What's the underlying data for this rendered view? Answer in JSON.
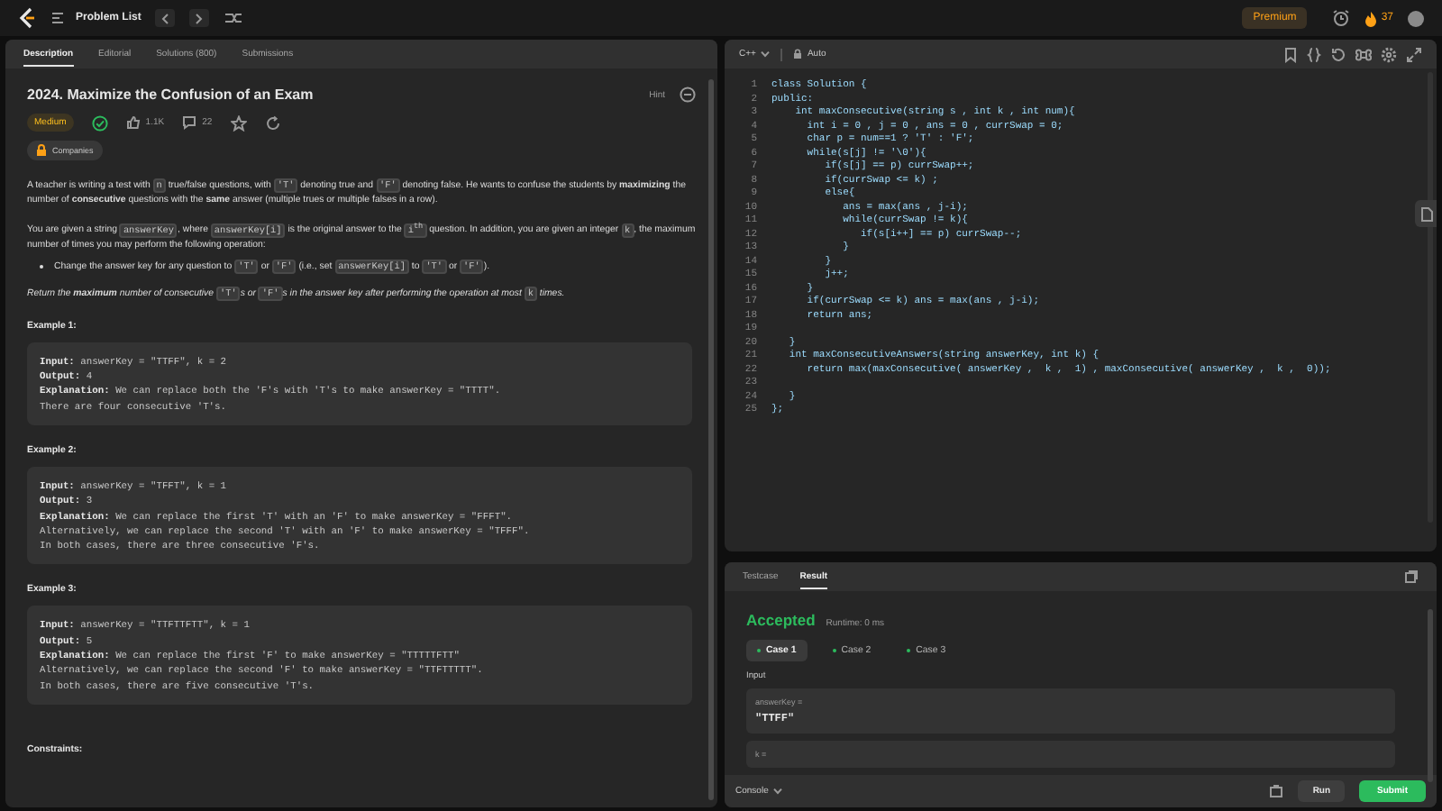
{
  "top_bar": {
    "title": "Problem List",
    "premium": "Premium",
    "streak": "37"
  },
  "description_panel": {
    "tabs": [
      {
        "label": "Description",
        "selected": true
      },
      {
        "label": "Editorial",
        "selected": false
      },
      {
        "label": "Solutions (800)",
        "selected": false
      },
      {
        "label": "Submissions",
        "selected": false
      }
    ],
    "title": "2024. Maximize the Confusion of an Exam",
    "hint": "Hint",
    "difficulty": "Medium",
    "solved": true,
    "likes": "1.1K",
    "comments": "22",
    "companies": "Companies",
    "paragraphs": [
      {
        "kind": "paragraph",
        "segments": [
          {
            "kind": "text",
            "text": "A teacher is writing a test with "
          },
          {
            "kind": "code",
            "text": "n"
          },
          {
            "kind": "text",
            "text": " true/false questions, with "
          },
          {
            "kind": "code",
            "text": "'T'"
          },
          {
            "kind": "text",
            "text": " denoting true and "
          },
          {
            "kind": "code",
            "text": "'F'"
          },
          {
            "kind": "text",
            "text": " denoting false. He wants to confuse the students by **maximizing** the number of **consecutive** questions with the **same** answer (multiple trues or multiple falses in a row)."
          }
        ]
      },
      {
        "kind": "paragraph",
        "segments": [
          {
            "kind": "text",
            "text": "You are given a string "
          },
          {
            "kind": "code",
            "text": "answerKey"
          },
          {
            "kind": "text",
            "text": ", where "
          },
          {
            "kind": "code",
            "text": "answerKey[i]"
          },
          {
            "kind": "text",
            "text": " is the original answer to the "
          },
          {
            "kind": "code",
            "text": "i$^{th}$"
          },
          {
            "kind": "text",
            "text": " question. In addition, you are given an integer "
          },
          {
            "kind": "code",
            "text": "k"
          },
          {
            "kind": "text",
            "text": ", the maximum number of times you may perform the following operation:"
          }
        ]
      },
      {
        "kind": "bullet",
        "segments": [
          {
            "kind": "text",
            "text": "Change the answer key for any question to "
          },
          {
            "kind": "code",
            "text": "'T'"
          },
          {
            "kind": "text",
            "text": " or "
          },
          {
            "kind": "code",
            "text": "'F'"
          },
          {
            "kind": "text",
            "text": " (i.e., set "
          },
          {
            "kind": "code",
            "text": "answerKey[i]"
          },
          {
            "kind": "text",
            "text": " to "
          },
          {
            "kind": "code",
            "text": "'T'"
          },
          {
            "kind": "text",
            "text": " or "
          },
          {
            "kind": "code",
            "text": "'F'"
          },
          {
            "kind": "text",
            "text": ")."
          }
        ]
      },
      {
        "kind": "note",
        "segments": [
          {
            "kind": "text",
            "text": "Return the **maximum** number of consecutive "
          },
          {
            "kind": "code",
            "text": "'T'"
          },
          {
            "kind": "text",
            "text": "s or "
          },
          {
            "kind": "code",
            "text": "'F'"
          },
          {
            "kind": "text",
            "text": "s in the answer key after performing the operation at most "
          },
          {
            "kind": "code",
            "text": "k"
          },
          {
            "kind": "text",
            "text": " times."
          }
        ]
      }
    ],
    "examples": [
      {
        "heading": "Example 1:",
        "lines": [
          "**Input:** answerKey = \"TTFF\", k = 2",
          "**Output:** 4",
          "**Explanation:** We can replace both the 'F's with 'T's to make answerKey = \"TTTT\".",
          "There are four consecutive 'T's."
        ]
      },
      {
        "heading": "Example 2:",
        "lines": [
          "**Input:** answerKey = \"TFFT\", k = 1",
          "**Output:** 3",
          "**Explanation:** We can replace the first 'T' with an 'F' to make answerKey = \"FFFT\".",
          "Alternatively, we can replace the second 'T' with an 'F' to make answerKey = \"TFFF\".",
          "In both cases, there are three consecutive 'F's."
        ]
      },
      {
        "heading": "Example 3:",
        "lines": [
          "**Input:** answerKey = \"TTFTTFTT\", k = 1",
          "**Output:** 5",
          "**Explanation:** We can replace the first 'F' to make answerKey = \"TTTTTFTT\"",
          "Alternatively, we can replace the second 'F' to make answerKey = \"TTFTTTTT\".",
          "In both cases, there are five consecutive 'T's."
        ]
      }
    ],
    "constraints_heading": "Constraints:"
  },
  "editor": {
    "language": "C++",
    "mode": "Auto",
    "lines": [
      {
        "n": "1",
        "code": "class Solution {"
      },
      {
        "n": "2",
        "code": "public:"
      },
      {
        "n": "3",
        "code": "    int maxConsecutive(string s , int k , int num){"
      },
      {
        "n": "4",
        "code": "      int i = 0 , j = 0 , ans = 0 , currSwap = 0;"
      },
      {
        "n": "5",
        "code": "      char p = num==1 ? 'T' : 'F';"
      },
      {
        "n": "6",
        "code": "      while(s[j] != '\\0'){"
      },
      {
        "n": "7",
        "code": "         if(s[j] == p) currSwap++;"
      },
      {
        "n": "8",
        "code": "         if(currSwap <= k) ;"
      },
      {
        "n": "9",
        "code": "         else{"
      },
      {
        "n": "10",
        "code": "            ans = max(ans , j-i);"
      },
      {
        "n": "11",
        "code": "            while(currSwap != k){"
      },
      {
        "n": "12",
        "code": "               if(s[i++] == p) currSwap--;"
      },
      {
        "n": "13",
        "code": "            }"
      },
      {
        "n": "14",
        "code": "         }"
      },
      {
        "n": "15",
        "code": "         j++;"
      },
      {
        "n": "16",
        "code": "      }"
      },
      {
        "n": "17",
        "code": "      if(currSwap <= k) ans = max(ans , j-i);"
      },
      {
        "n": "18",
        "code": "      return ans;"
      },
      {
        "n": "19"
      },
      {
        "n": "20",
        "code": "   }"
      },
      {
        "n": "21",
        "code": "   int maxConsecutiveAnswers(string answerKey, int k) {"
      },
      {
        "n": "22",
        "code": "      return max(maxConsecutive( answerKey ,  k ,  1) , maxConsecutive( answerKey ,  k ,  0));"
      },
      {
        "n": "23"
      },
      {
        "n": "24",
        "code": "   }"
      },
      {
        "n": "25",
        "code": "};"
      }
    ]
  },
  "result_panel": {
    "tabs": [
      {
        "label": "Testcase",
        "selected": false
      },
      {
        "label": "Result",
        "selected": true
      }
    ],
    "verdict": "Accepted",
    "runtime": "Runtime: 0 ms",
    "cases": [
      {
        "label": "Case 1",
        "selected": true
      },
      {
        "label": "Case 2",
        "selected": false
      },
      {
        "label": "Case 3",
        "selected": false
      }
    ],
    "input_label": "Input",
    "inputs": [
      {
        "name": "answerKey =",
        "value": "\"TTFF\""
      },
      {
        "name": "k ="
      }
    ],
    "console": "Console",
    "run": "Run",
    "submit": "Submit"
  }
}
